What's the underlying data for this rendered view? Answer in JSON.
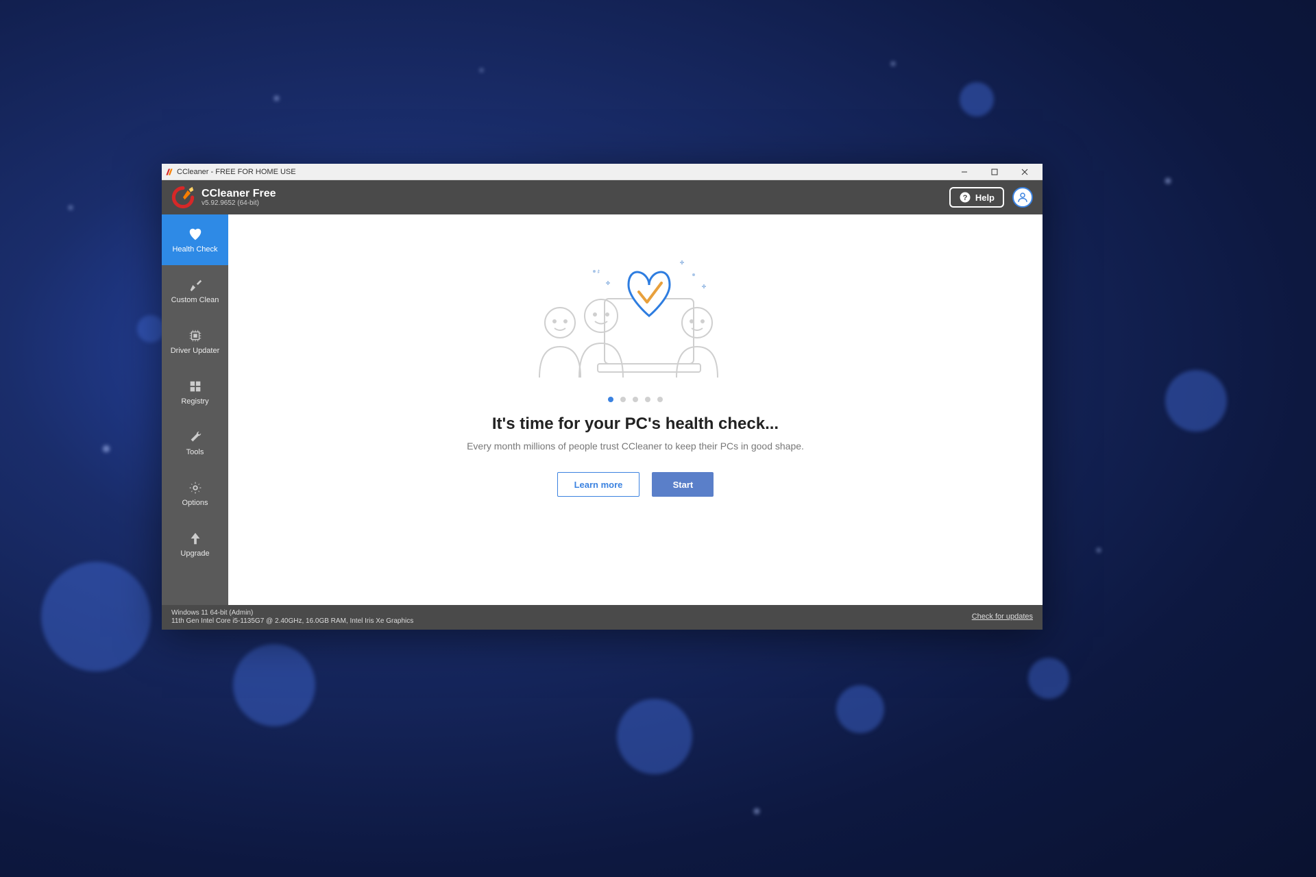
{
  "titlebar": {
    "text": "CCleaner - FREE FOR HOME USE"
  },
  "header": {
    "product_name": "CCleaner Free",
    "version": "v5.92.9652 (64-bit)",
    "help_label": "Help"
  },
  "sidebar": {
    "items": [
      {
        "label": "Health Check"
      },
      {
        "label": "Custom Clean"
      },
      {
        "label": "Driver Updater"
      },
      {
        "label": "Registry"
      },
      {
        "label": "Tools"
      },
      {
        "label": "Options"
      },
      {
        "label": "Upgrade"
      }
    ]
  },
  "main": {
    "headline": "It's time for your PC's health check...",
    "subtext": "Every month millions of people trust CCleaner to keep their PCs in good shape.",
    "learn_more_label": "Learn more",
    "start_label": "Start"
  },
  "statusbar": {
    "line1": "Windows 11 64-bit (Admin)",
    "line2": "11th Gen Intel Core i5-1135G7 @ 2.40GHz, 16.0GB RAM, Intel Iris Xe Graphics",
    "check_updates": "Check for updates"
  }
}
